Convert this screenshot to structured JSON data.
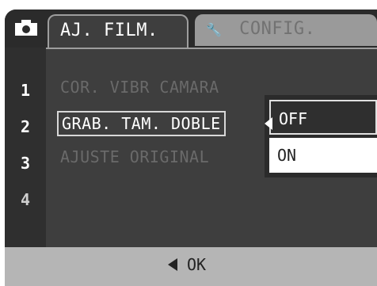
{
  "tabs": [
    {
      "label": "AJ. FILM.",
      "active": true
    },
    {
      "icon": "wrench-icon",
      "label": "CONFIG.",
      "active": false
    }
  ],
  "menu": {
    "numbers": [
      "1",
      "2",
      "3",
      "4"
    ],
    "items": [
      {
        "label": "COR. VIBR CAMARA"
      },
      {
        "label": "GRAB. TAM. DOBLE"
      },
      {
        "label": "AJUSTE ORIGINAL"
      }
    ]
  },
  "dropdown": {
    "options": [
      {
        "label": "OFF"
      },
      {
        "label": "ON"
      }
    ]
  },
  "footer": {
    "ok_label": "OK"
  }
}
